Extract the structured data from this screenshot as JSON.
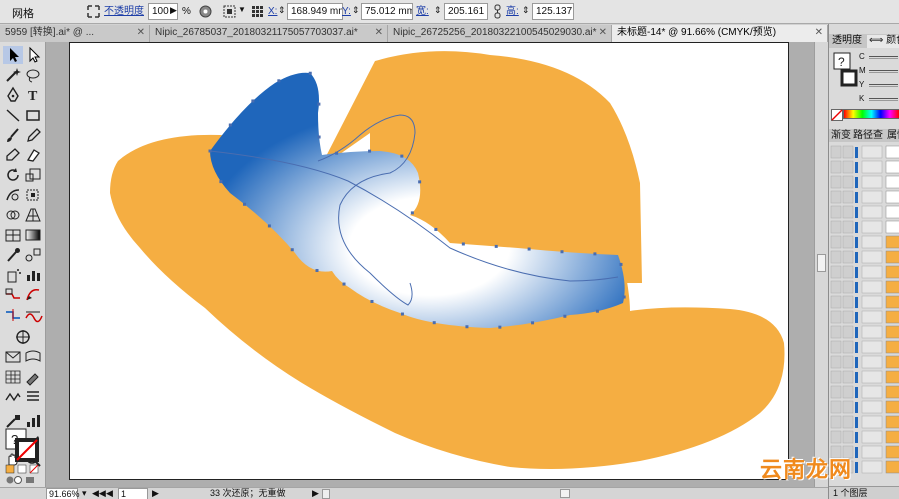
{
  "control_bar": {
    "mode_label": "网格",
    "opacity_label": "不透明度",
    "opacity_value": "100",
    "opacity_unit": "%",
    "x_label": "X:",
    "x_value": "168.949 mm",
    "y_label": "Y:",
    "y_value": "75.012 mm",
    "width_label": "宽:",
    "width_value": "205.161 mi",
    "height_label": "高:",
    "height_value": "125.137 mi"
  },
  "tabs": [
    {
      "label": "5959 [转换].ai* @ ...",
      "close": "✕"
    },
    {
      "label": "Nipic_26785037_20180321175057703037.ai*",
      "close": "✕"
    },
    {
      "label": "Nipic_26725256_20180322100545029030.ai*",
      "close": "✕"
    },
    {
      "label": "未标题-14* @ 91.66% (CMYK/预览)",
      "close": "✕"
    }
  ],
  "status_bar": {
    "zoom": "91.66%",
    "page": "1",
    "history": "33 次还原；无重做"
  },
  "panels": {
    "tab_transparency": "透明度",
    "tab_color": "颜色",
    "cmyk": [
      "C",
      "M",
      "Y",
      "K"
    ],
    "tab_gradient": "渐变",
    "tab_pathfinder": "路径查",
    "tab_attributes": "属性",
    "layers_footer": "1 个图层"
  },
  "artwork": {
    "hat_color": "#F5AE42",
    "gradient_dark": "#1F66BB",
    "gradient_light": "#FFFFFF",
    "path_color": "#4A6DB0"
  },
  "watermark": "云南龙网"
}
